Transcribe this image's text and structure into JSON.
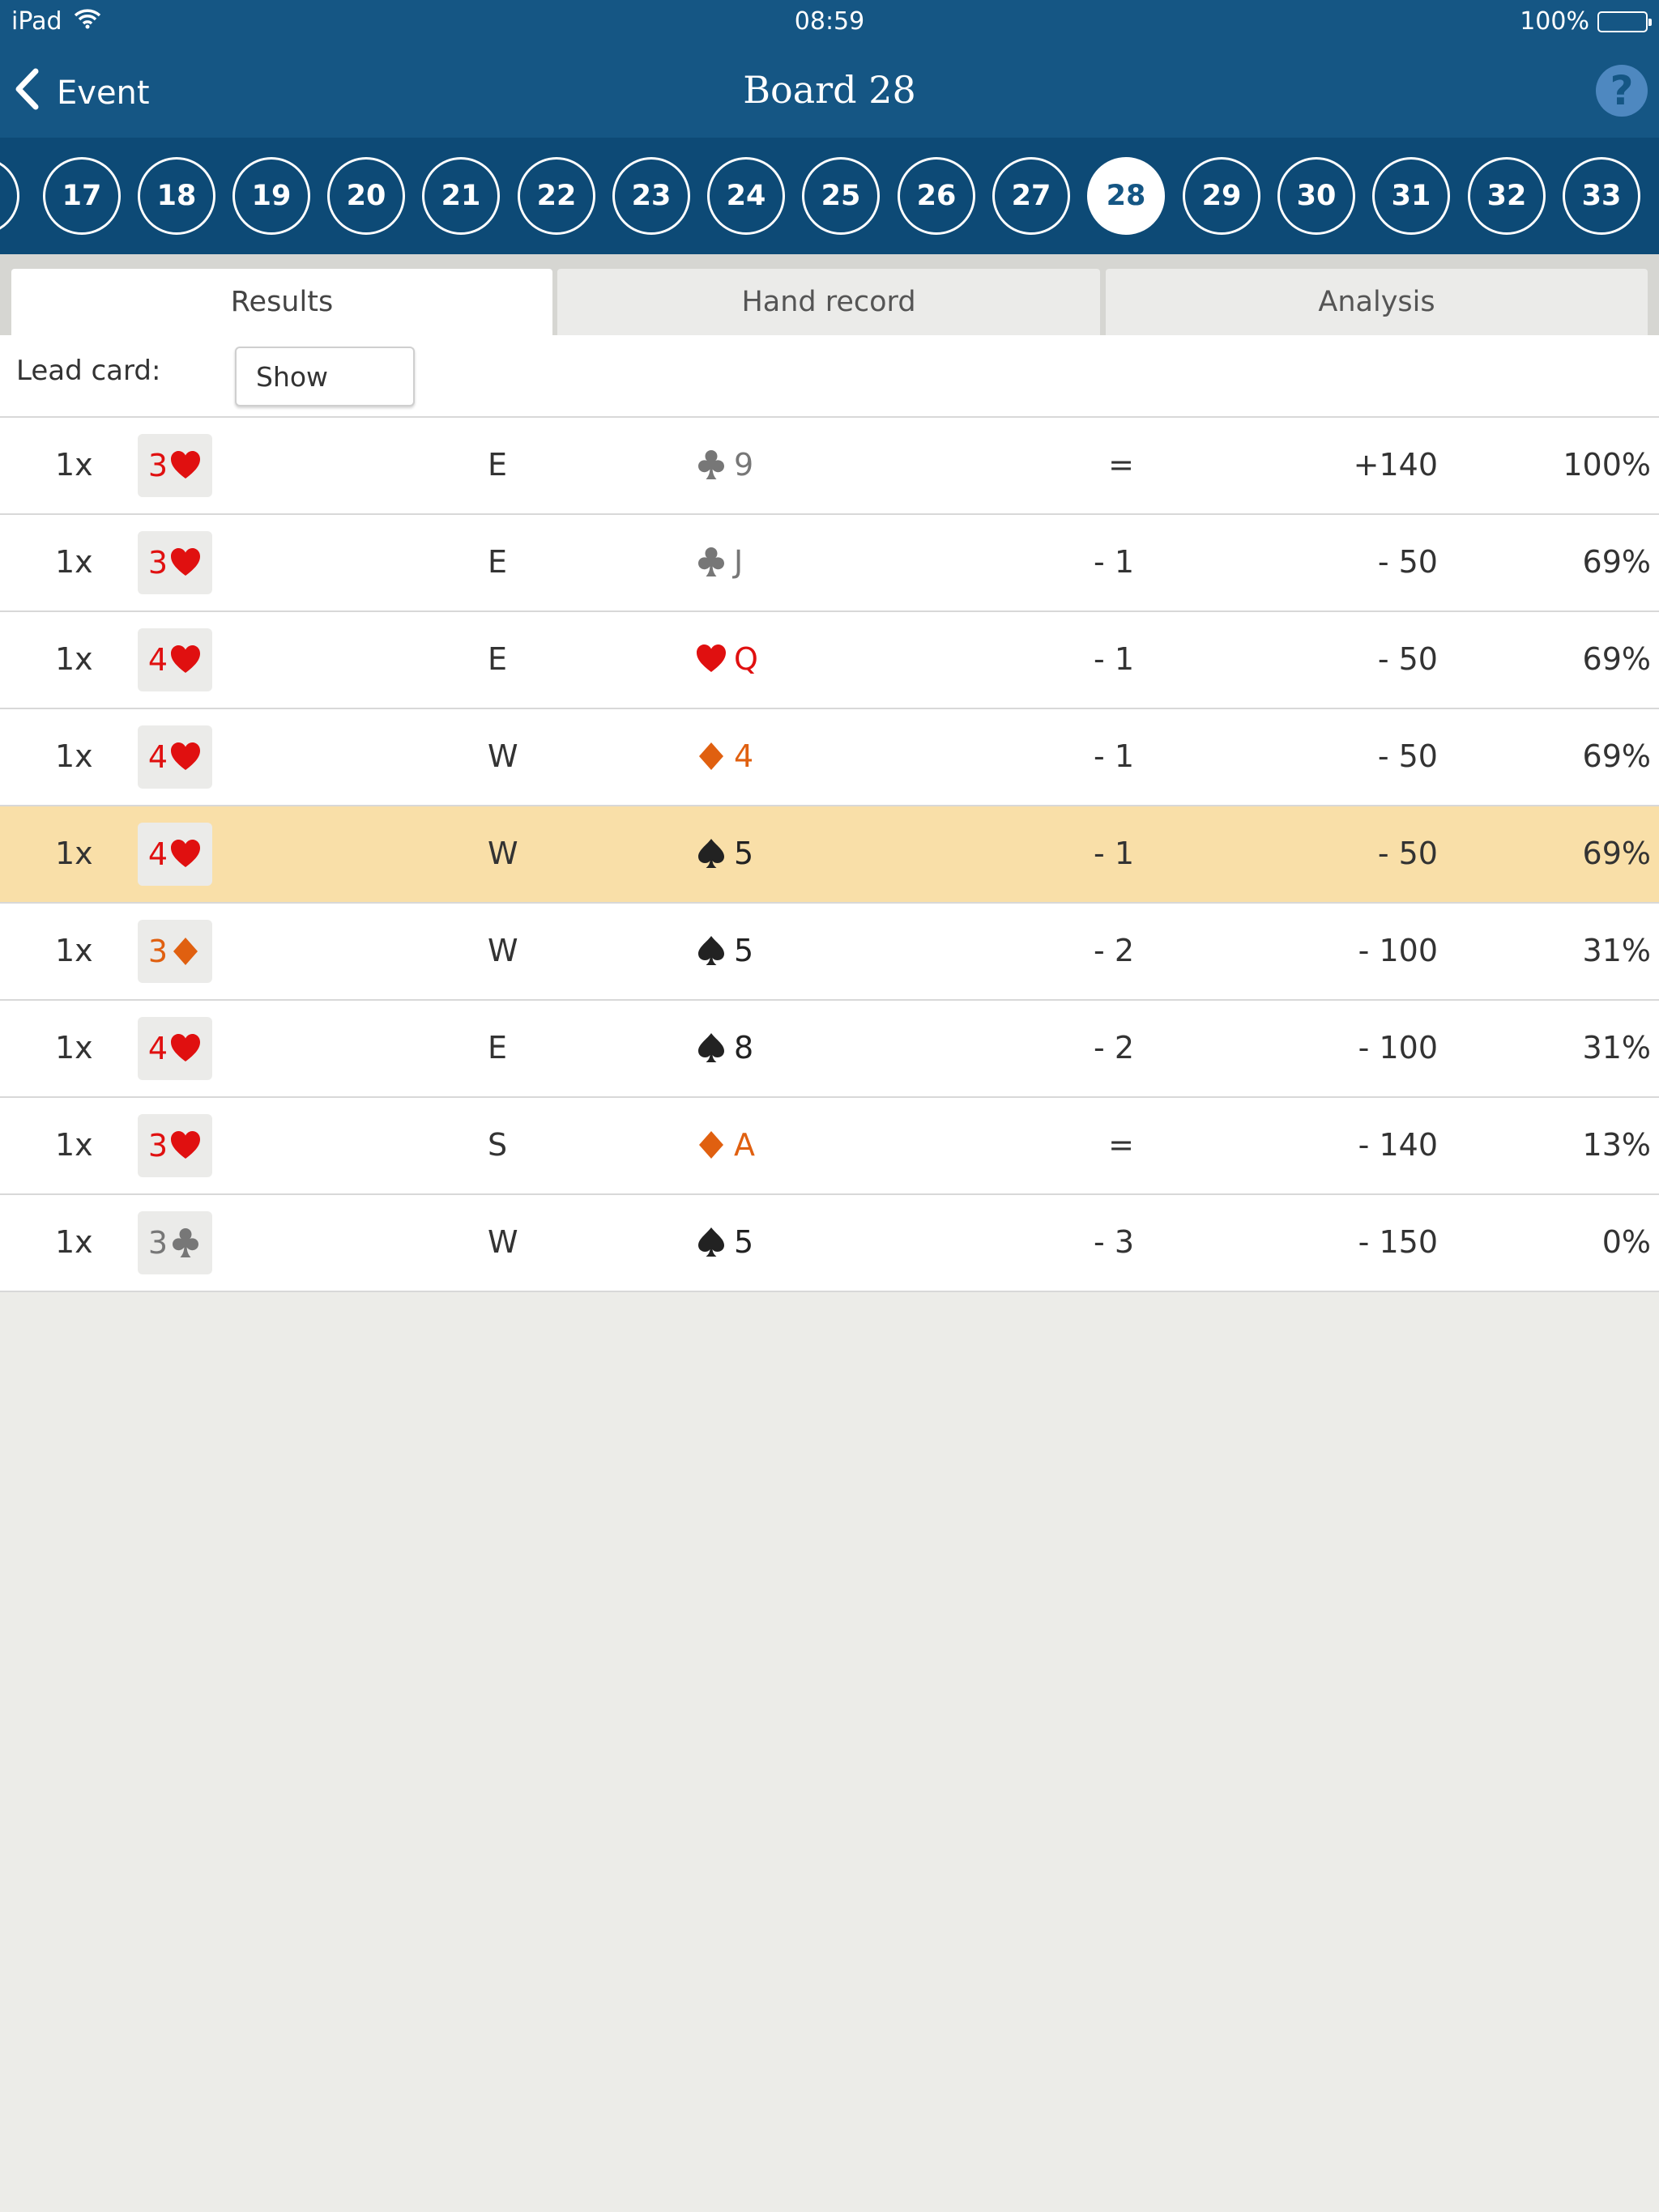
{
  "status_bar": {
    "device": "iPad",
    "time": "08:59",
    "battery": "100%"
  },
  "nav": {
    "back_label": "Event",
    "title": "Board 28",
    "help_label": "?"
  },
  "board_selector": {
    "boards": [
      "17",
      "18",
      "19",
      "20",
      "21",
      "22",
      "23",
      "24",
      "25",
      "26",
      "27",
      "28",
      "29",
      "30",
      "31",
      "32",
      "33"
    ],
    "active": "28"
  },
  "tabs": {
    "results": "Results",
    "hand_record": "Hand record",
    "analysis": "Analysis",
    "active": "Results"
  },
  "lead_card": {
    "label": "Lead card:",
    "button": "Show"
  },
  "colors": {
    "header": "#155684",
    "board_bar": "#0d4a76",
    "hearts": "#e01010",
    "diamonds": "#e06010",
    "clubs": "#777777",
    "spades": "#222222",
    "highlight": "#f9dfa8"
  },
  "results": [
    {
      "count": "1x",
      "level": "3",
      "suit": "hearts",
      "declarer": "E",
      "lead_suit": "clubs",
      "lead_rank": "9",
      "result": "=",
      "score": "+140",
      "percent": "100%",
      "highlighted": false
    },
    {
      "count": "1x",
      "level": "3",
      "suit": "hearts",
      "declarer": "E",
      "lead_suit": "clubs",
      "lead_rank": "J",
      "result": "- 1",
      "score": "- 50",
      "percent": "69%",
      "highlighted": false
    },
    {
      "count": "1x",
      "level": "4",
      "suit": "hearts",
      "declarer": "E",
      "lead_suit": "hearts",
      "lead_rank": "Q",
      "result": "- 1",
      "score": "- 50",
      "percent": "69%",
      "highlighted": false
    },
    {
      "count": "1x",
      "level": "4",
      "suit": "hearts",
      "declarer": "W",
      "lead_suit": "diamonds",
      "lead_rank": "4",
      "result": "- 1",
      "score": "- 50",
      "percent": "69%",
      "highlighted": false
    },
    {
      "count": "1x",
      "level": "4",
      "suit": "hearts",
      "declarer": "W",
      "lead_suit": "spades",
      "lead_rank": "5",
      "result": "- 1",
      "score": "- 50",
      "percent": "69%",
      "highlighted": true
    },
    {
      "count": "1x",
      "level": "3",
      "suit": "diamonds",
      "declarer": "W",
      "lead_suit": "spades",
      "lead_rank": "5",
      "result": "- 2",
      "score": "- 100",
      "percent": "31%",
      "highlighted": false
    },
    {
      "count": "1x",
      "level": "4",
      "suit": "hearts",
      "declarer": "E",
      "lead_suit": "spades",
      "lead_rank": "8",
      "result": "- 2",
      "score": "- 100",
      "percent": "31%",
      "highlighted": false
    },
    {
      "count": "1x",
      "level": "3",
      "suit": "hearts",
      "declarer": "S",
      "lead_suit": "diamonds",
      "lead_rank": "A",
      "result": "=",
      "score": "- 140",
      "percent": "13%",
      "highlighted": false
    },
    {
      "count": "1x",
      "level": "3",
      "suit": "clubs",
      "declarer": "W",
      "lead_suit": "spades",
      "lead_rank": "5",
      "result": "- 3",
      "score": "- 150",
      "percent": "0%",
      "highlighted": false
    }
  ]
}
